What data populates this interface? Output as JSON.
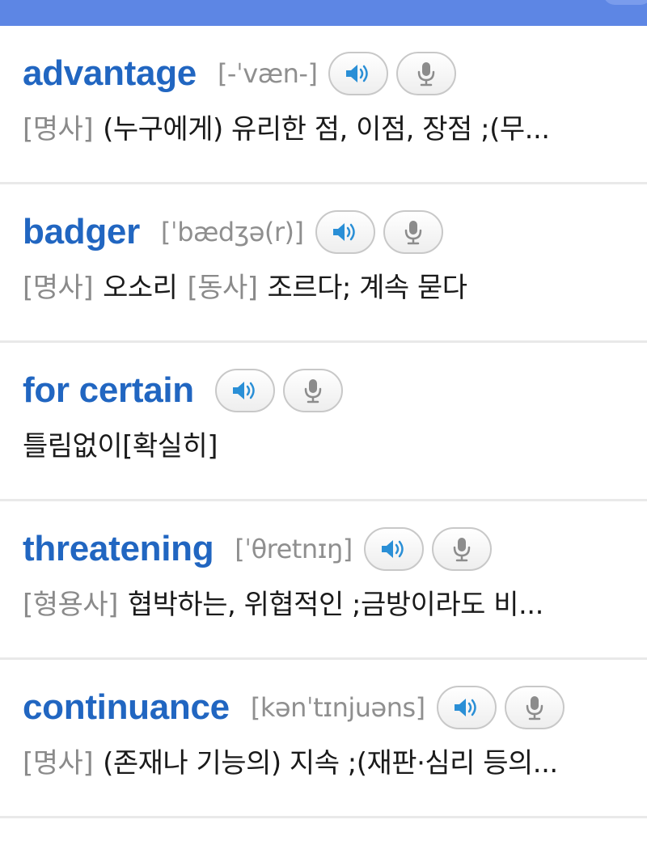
{
  "entries": [
    {
      "word": "advantage",
      "pron": "[-ˈvæn-]",
      "pos": "[명사]",
      "def": "(누구에게) 유리한 점, 이점, 장점 ;(무..."
    },
    {
      "word": "badger",
      "pron": "[ˈbædʒə(r)]",
      "pos": "[명사]",
      "def": "오소리",
      "pos2": "[동사]",
      "def2": "조르다; 계속 묻다"
    },
    {
      "word": "for certain",
      "pron": "",
      "pos": "",
      "def": "틀림없이[확실히]"
    },
    {
      "word": "threatening",
      "pron": "[ˈθretnɪŋ]",
      "pos": "[형용사]",
      "def": "협박하는, 위협적인 ;금방이라도 비..."
    },
    {
      "word": "continuance",
      "pron": "[kənˈtɪnjuəns]",
      "pos": "[명사]",
      "def": "(존재나 기능의) 지속 ;(재판·심리 등의..."
    }
  ],
  "icons": {
    "audio": "speaker-icon",
    "record": "microphone-icon"
  },
  "colors": {
    "top_bar": "#5d86e4",
    "word": "#2166c1",
    "pronunciation": "#8f8f8f",
    "speaker": "#2a8fd6",
    "microphone": "#8c8c8c",
    "divider": "#e9e9e9"
  }
}
